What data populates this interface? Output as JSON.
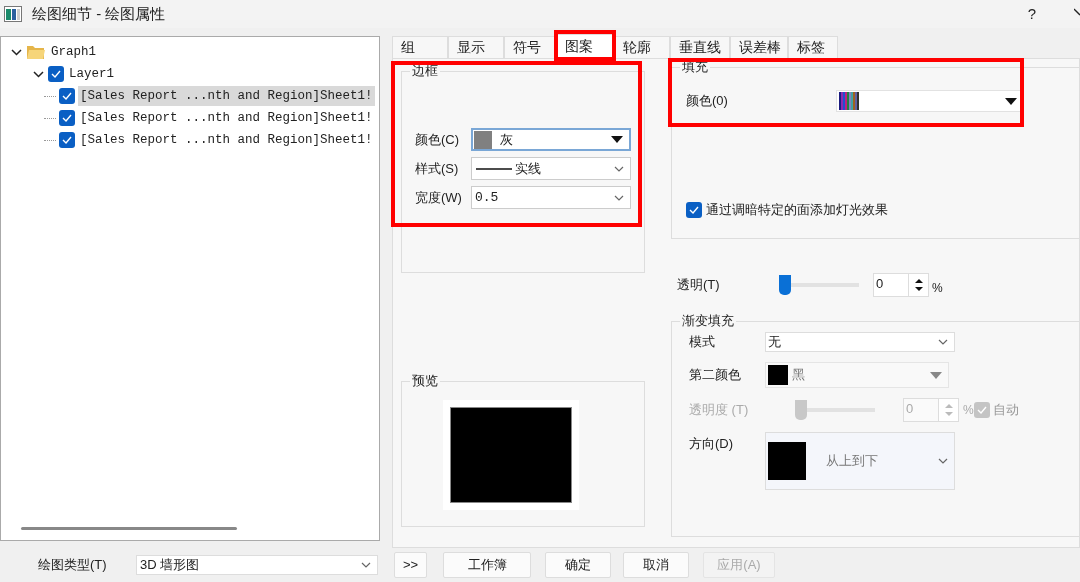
{
  "window": {
    "title": "绘图细节 - 绘图属性",
    "help": "?"
  },
  "tree": {
    "items": [
      {
        "label": "Graph1",
        "kind": "folder",
        "expanded": true,
        "children": [
          {
            "label": "Layer1",
            "kind": "layer",
            "checked": true,
            "expanded": true,
            "children": [
              {
                "label": "[Sales Report ...nth and Region]Sheet1!",
                "kind": "plot",
                "checked": true,
                "selected": true
              },
              {
                "label": "[Sales Report ...nth and Region]Sheet1!",
                "kind": "plot",
                "checked": true,
                "selected": false
              },
              {
                "label": "[Sales Report ...nth and Region]Sheet1!",
                "kind": "plot",
                "checked": true,
                "selected": false
              }
            ]
          }
        ]
      }
    ]
  },
  "tabs": [
    {
      "label": "组",
      "selected": false
    },
    {
      "label": "显示",
      "selected": false
    },
    {
      "label": "符号",
      "selected": false
    },
    {
      "label": "图案",
      "selected": true
    },
    {
      "label": "轮廓",
      "selected": false
    },
    {
      "label": "垂直线",
      "selected": false
    },
    {
      "label": "误差棒",
      "selected": false
    },
    {
      "label": "标签",
      "selected": false
    }
  ],
  "border": {
    "title": "边框",
    "fields": [
      {
        "label": "颜色(C)",
        "value": "灰",
        "kind": "color",
        "color": "#808080"
      },
      {
        "label": "样式(S)",
        "value": "实线",
        "kind": "line"
      },
      {
        "label": "宽度(W)",
        "value": "0.5",
        "kind": "plain"
      }
    ]
  },
  "preview": {
    "title": "预览"
  },
  "fill": {
    "title": "填充",
    "color_label": "颜色(0)",
    "lighting": {
      "label": "通过调暗特定的面添加灯光效果",
      "checked": true
    }
  },
  "transparency": {
    "label": "透明(T)",
    "level": 0,
    "value": "0",
    "unit": "%"
  },
  "gradient": {
    "title": "渐变填充",
    "mode": {
      "label": "模式",
      "value": "无"
    },
    "second_color": {
      "label": "第二颜色",
      "value": "黑",
      "color": "#000000"
    },
    "opacity": {
      "label": "透明度 (T)",
      "level": 0,
      "value": "0",
      "unit": "%",
      "disabled": true
    },
    "auto": {
      "label": "自动",
      "checked": true,
      "disabled": true
    },
    "direction": {
      "label": "方向(D)",
      "value": "从上到下"
    }
  },
  "plot_type": {
    "label": "绘图类型(T)",
    "value": "3D 墙形图"
  },
  "buttons": [
    {
      "label": ">>",
      "disabled": false
    },
    {
      "label": "工作簿",
      "disabled": false
    },
    {
      "label": "确定",
      "disabled": false
    },
    {
      "label": "取消",
      "disabled": false
    },
    {
      "label": "应用(A)",
      "disabled": true
    }
  ]
}
